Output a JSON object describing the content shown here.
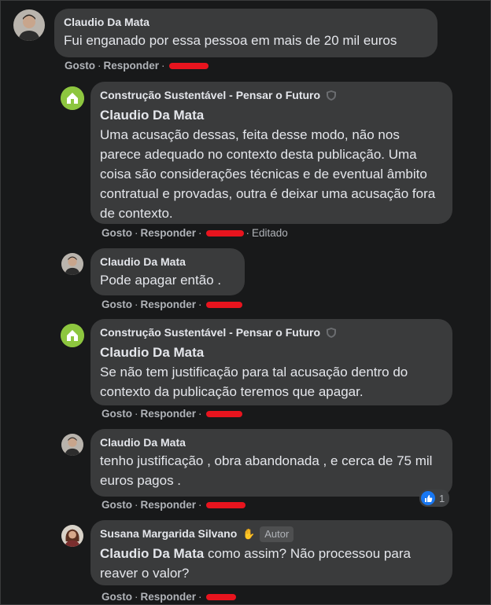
{
  "comments": [
    {
      "author": "Claudio Da Mata",
      "text": "Fui enganado por essa pessoa em mais de 20 mil euros",
      "actions": {
        "like": "Gosto",
        "reply": "Responder"
      }
    },
    {
      "author": "Construção Sustentável - Pensar o Futuro",
      "mention": "Claudio Da Mata",
      "text": "Uma acusação dessas, feita desse modo, não nos parece adequado no contexto desta publicação. Uma coisa são considerações técnicas e de eventual âmbito contratual e provadas, outra é deixar uma acusação fora de contexto.",
      "actions": {
        "like": "Gosto",
        "reply": "Responder",
        "edited": "Editado"
      }
    },
    {
      "author": "Claudio Da Mata",
      "text": "Pode apagar então .",
      "actions": {
        "like": "Gosto",
        "reply": "Responder"
      }
    },
    {
      "author": "Construção Sustentável - Pensar o Futuro",
      "mention": "Claudio Da Mata",
      "text": "Se não tem justificação para tal acusação dentro do contexto da publicação teremos que apagar.",
      "actions": {
        "like": "Gosto",
        "reply": "Responder"
      }
    },
    {
      "author": "Claudio Da Mata",
      "text": "tenho justificação , obra abandonada , e cerca de 75 mil euros pagos .",
      "actions": {
        "like": "Gosto",
        "reply": "Responder"
      },
      "reactions": {
        "icon": "like-icon",
        "count": "1"
      }
    },
    {
      "author": "Susana Margarida Silvano",
      "author_badge": "Autor",
      "mention": "Claudio Da Mata",
      "text": "como assim? Não processou para reaver o valor?",
      "actions": {
        "like": "Gosto",
        "reply": "Responder"
      }
    }
  ],
  "colors": {
    "background": "#18191a",
    "bubble": "#3a3b3c",
    "text": "#e4e6eb",
    "muted": "#b0b3b8",
    "page_avatar": "#8dc63f",
    "like_blue": "#1877f2",
    "redaction": "#e8141e"
  }
}
